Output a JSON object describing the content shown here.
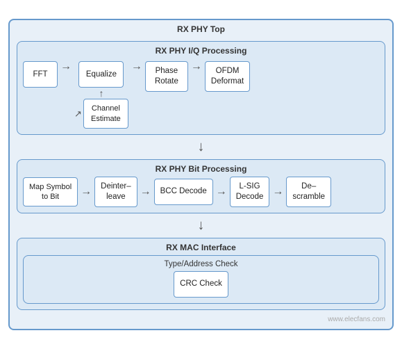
{
  "diagram": {
    "outer_title": "RX PHY Top",
    "iq_section": {
      "title": "RX PHY I/Q Processing",
      "blocks": {
        "fft": "FFT",
        "equalize": "Equalize",
        "channel_estimate": "Channel\nEstimate",
        "phase_rotate": "Phase\nRotate",
        "ofdm_deformat": "OFDM\nDeformat"
      }
    },
    "bit_section": {
      "title": "RX PHY Bit Processing",
      "blocks": {
        "map_symbol": "Map Symbol\nto Bit",
        "deinterleave": "Deinter–\nleave",
        "bcc_decode": "BCC Decode",
        "lsig_decode": "L-SIG\nDecode",
        "descramble": "De–\nscramble"
      }
    },
    "mac_section": {
      "title": "RX MAC Interface",
      "inner": {
        "title": "Type/Address Check",
        "block": "CRC Check"
      }
    }
  },
  "watermark": "www.elecfans.com"
}
